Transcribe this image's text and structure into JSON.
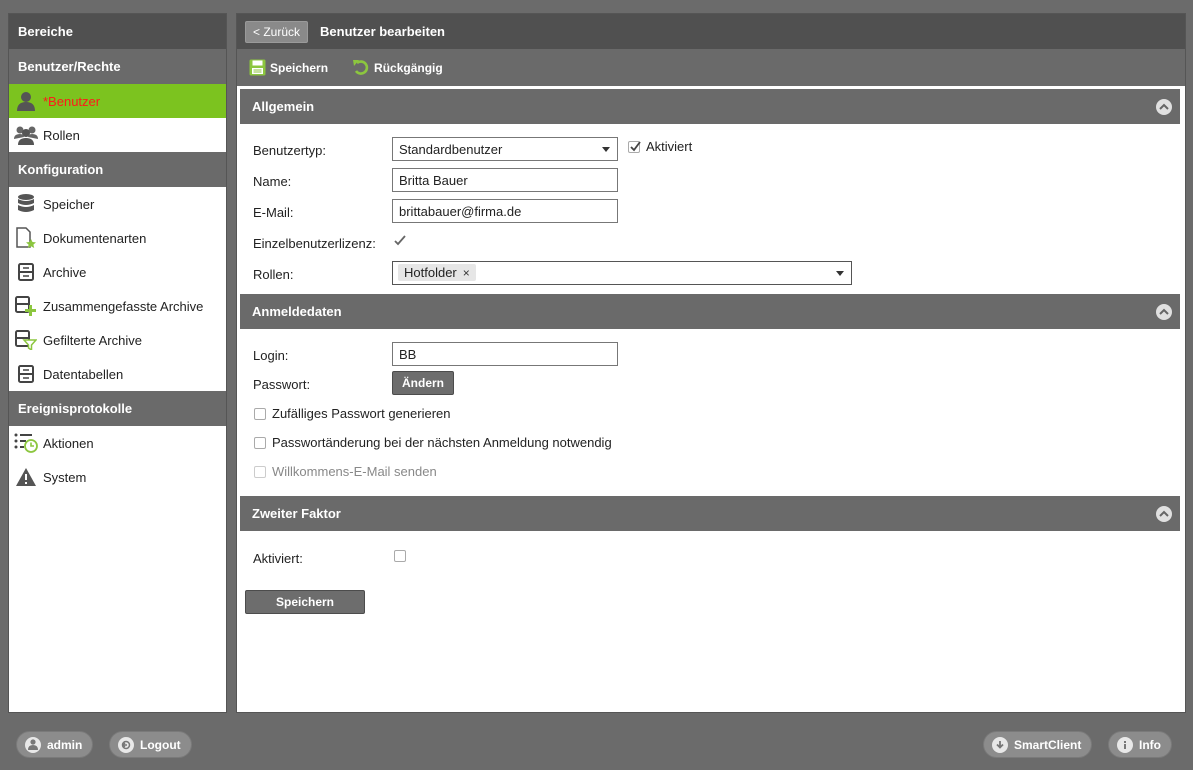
{
  "sidebar": {
    "header": "Bereiche",
    "sections": [
      {
        "title": "Benutzer/Rechte",
        "items": [
          {
            "label": "*Benutzer",
            "icon": "user-icon",
            "active": true
          },
          {
            "label": "Rollen",
            "icon": "users-group-icon"
          }
        ]
      },
      {
        "title": "Konfiguration",
        "items": [
          {
            "label": "Speicher",
            "icon": "database-icon"
          },
          {
            "label": "Dokumentenarten",
            "icon": "document-star-icon"
          },
          {
            "label": "Archive",
            "icon": "archive-icon"
          },
          {
            "label": "Zusammengefasste Archive",
            "icon": "archive-plus-icon"
          },
          {
            "label": "Gefilterte Archive",
            "icon": "archive-filter-icon"
          },
          {
            "label": "Datentabellen",
            "icon": "table-icon"
          }
        ]
      },
      {
        "title": "Ereignisprotokolle",
        "items": [
          {
            "label": "Aktionen",
            "icon": "actions-clock-icon"
          },
          {
            "label": "System",
            "icon": "warning-icon"
          }
        ]
      }
    ]
  },
  "header": {
    "back_label": "< Zurück",
    "title": "Benutzer bearbeiten"
  },
  "toolbar": {
    "save_label": "Speichern",
    "undo_label": "Rückgängig"
  },
  "general": {
    "title": "Allgemein",
    "user_type_label": "Benutzertyp:",
    "user_type_value": "Standardbenutzer",
    "activated_label": "Aktiviert",
    "activated": true,
    "name_label": "Name:",
    "name_value": "Britta Bauer",
    "email_label": "E-Mail:",
    "email_value": "brittabauer@firma.de",
    "single_license_label": "Einzelbenutzerlizenz:",
    "single_license": true,
    "roles_label": "Rollen:",
    "roles": [
      "Hotfolder"
    ]
  },
  "login": {
    "title": "Anmeldedaten",
    "login_label": "Login:",
    "login_value": "BB",
    "password_label": "Passwort:",
    "change_button": "Ändern",
    "random_pw_label": "Zufälliges Passwort generieren",
    "change_next_label": "Passwortänderung bei der nächsten Anmeldung notwendig",
    "welcome_mail_label": "Willkommens-E-Mail senden"
  },
  "twofactor": {
    "title": "Zweiter Faktor",
    "activated_label": "Aktiviert:"
  },
  "save_button": "Speichern",
  "footer": {
    "user_label": "admin",
    "logout_label": "Logout",
    "smartclient_label": "SmartClient",
    "info_label": "Info"
  },
  "colors": {
    "accent": "#7cc31f",
    "active_text": "#ff1a1a",
    "panel_dark": "#505050",
    "panel_mid": "#6a6a6a"
  }
}
